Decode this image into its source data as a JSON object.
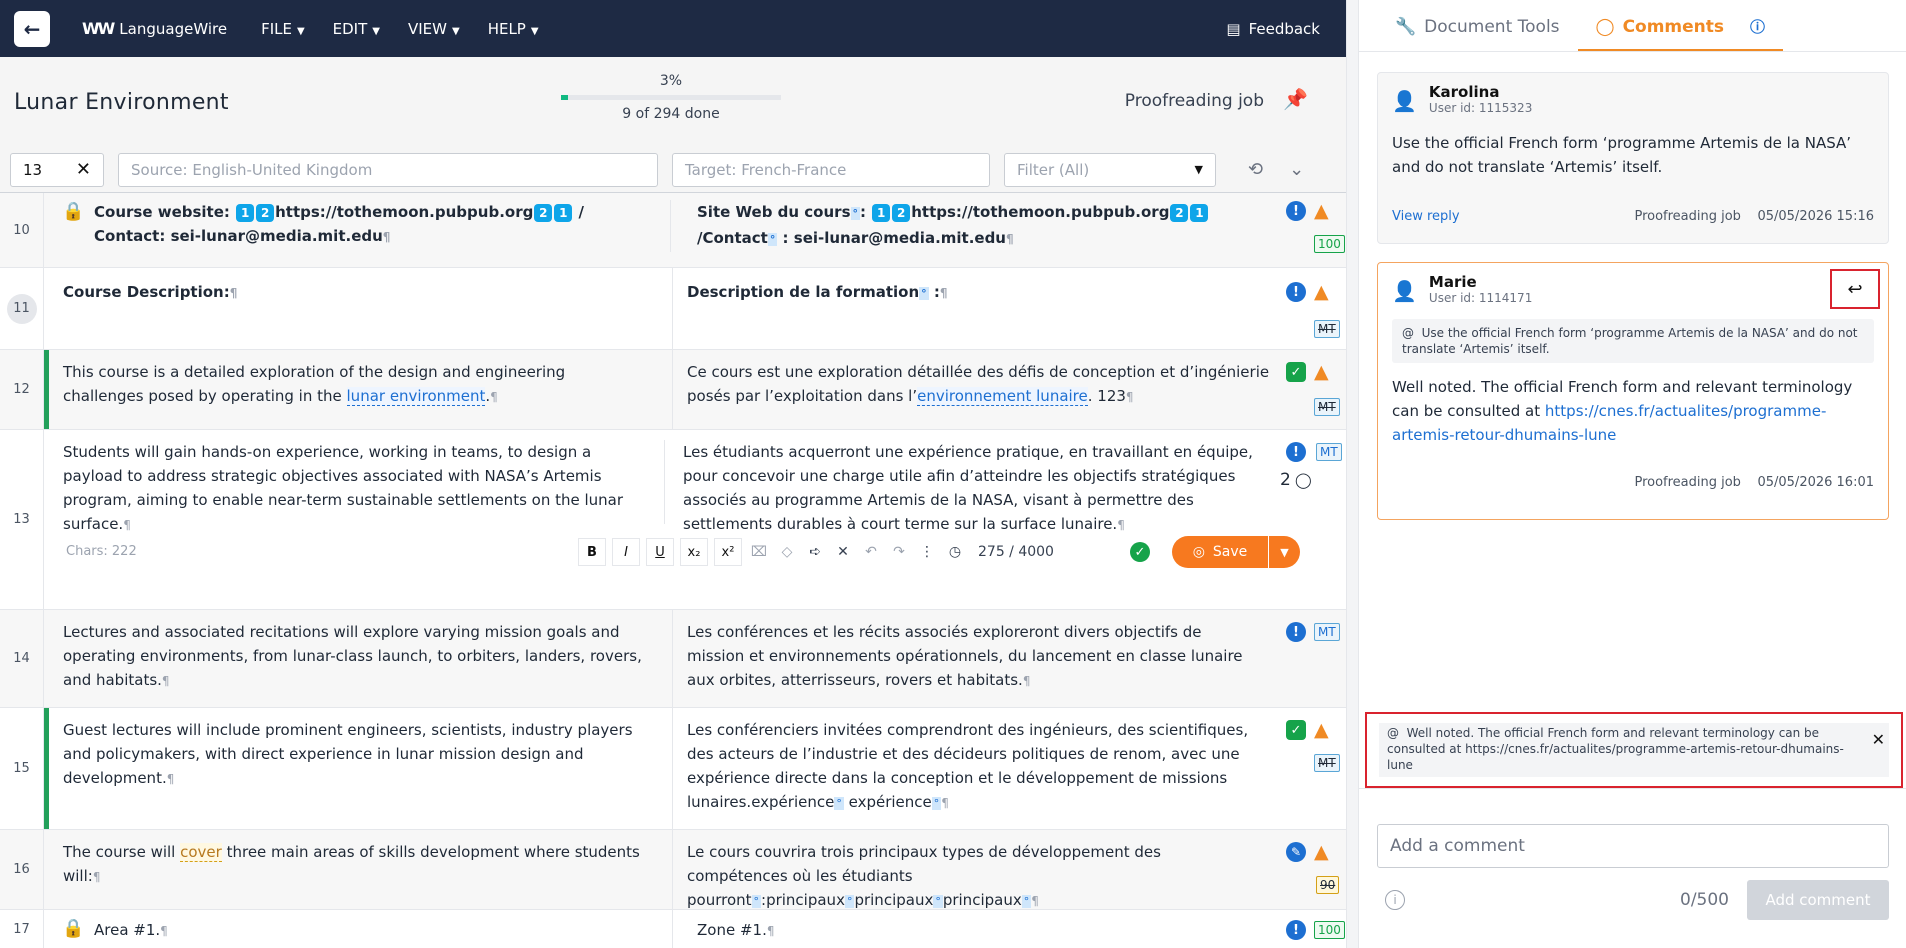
{
  "topbar": {
    "brand": "LanguageWire",
    "menu": [
      "FILE",
      "EDIT",
      "VIEW",
      "HELP"
    ],
    "feedback": "Feedback"
  },
  "doc": {
    "title": "Lunar Environment",
    "progress_percent": "3%",
    "progress_fraction": 0.03,
    "progress_text": "9 of 294 done",
    "job": "Proofreading job"
  },
  "filters": {
    "segment_number": "13",
    "source_placeholder": "Source: English-United Kingdom",
    "target_placeholder": "Target: French-France",
    "filter_value": "Filter (All)"
  },
  "segments": [
    {
      "id": "10",
      "src_a": "Course website: ",
      "src_b": "https://tothemoon.pubpub.org",
      "src_c": " / Contact: sei-lunar@media.mit.edu",
      "tgt_a": "Site Web du cours",
      "tgt_b": "https://tothemoon.pubpub.org",
      "tgt_c": " /Contact",
      "tgt_d": " : sei-lunar@media.mit.edu",
      "badge": "100"
    },
    {
      "id": "11",
      "src": "Course Description:",
      "tgt": "Description de la formation",
      "tgt_after": " :",
      "badge": "MT"
    },
    {
      "id": "12",
      "src_a": "This course is a detailed exploration of the design and engineering challenges posed by operating in the ",
      "src_term": "lunar environment",
      "src_c": ".",
      "tgt_a": "Ce cours est une exploration détaillée des défis de conception et d’ingénierie posés par l’exploitation dans l’",
      "tgt_term": "environnement lunaire",
      "tgt_c": ". 123",
      "badge": "MT"
    },
    {
      "id": "13",
      "src": "Students will gain hands-on experience, working in teams, to design a payload to address strategic objectives associated with NASA’s Artemis program, aiming to enable near-term sustainable settlements on the lunar surface.",
      "tgt": "Les étudiants acquerront une expérience pratique, en travaillant en équipe, pour concevoir une charge utile afin d’atteindre les objectifs stratégiques associés au programme Artemis de la NASA, visant à permettre des settlements durables à court terme sur la surface lunaire.",
      "badge": "MT",
      "comment_count": "2",
      "chars": "Chars: 222",
      "counter": "275 / 4000",
      "save": "Save"
    },
    {
      "id": "14",
      "src": "Lectures and associated recitations will explore varying mission goals and operating environments, from lunar-class launch, to orbiters, landers, rovers, and habitats.",
      "tgt": "Les conférences et les récits associés exploreront divers objectifs de mission et environnements opérationnels, du lancement en classe lunaire aux orbites, atterrisseurs, rovers et habitats.",
      "badge": "MT"
    },
    {
      "id": "15",
      "src": "Guest lectures will include prominent engineers, scientists, industry players and policymakers, with direct experience in lunar mission design and development.",
      "tgt_a": "Les conférenciers invitées comprendront des ingénieurs, des scientifiques, des acteurs de l’industrie et des décideurs politiques de renom, avec une expérience directe dans la conception et le développement de missions lunaires.expérience",
      "tgt_b": "expérience",
      "badge": "MT"
    },
    {
      "id": "16",
      "src_a": "The course will ",
      "src_hl": "cover",
      "src_c": " three main areas of skills development where students will:",
      "tgt_a": "Le cours couvrira trois principaux types de développement des compétences où les étudiants pourront",
      "tgt_b": ":principaux",
      "tgt_c": "principaux",
      "tgt_d": "principaux",
      "badge": "90"
    },
    {
      "id": "17",
      "src": "Area #1.",
      "tgt": "Zone #1.",
      "badge": "100"
    }
  ],
  "panel": {
    "tab_tools": "Document Tools",
    "tab_comments": "Comments",
    "comments": [
      {
        "name": "Karolina",
        "uid": "User id: 1115323",
        "text": "Use the official French form ‘programme Artemis de la NASA’ and do not translate ‘Artemis’ itself.",
        "view_reply": "View reply",
        "job": "Proofreading job",
        "date": "05/05/2026 15:16"
      },
      {
        "name": "Marie",
        "uid": "User id: 1114171",
        "quote": "Use the official French form ‘programme Artemis de la NASA’ and do not translate ‘Artemis’ itself.",
        "text": "Well noted. The official French form and relevant terminology can be consulted at ",
        "link": "https://cnes.fr/actualites/programme-artemis-retour-dhumains-lune",
        "job": "Proofreading job",
        "date": "05/05/2026 16:01"
      }
    ],
    "reply_quote": "Well noted. The official French form and relevant terminology can be consulted at https://cnes.fr/actualites/programme-artemis-retour-dhumains-lune",
    "add_placeholder": "Add a comment",
    "char_count": "0/500",
    "add_button": "Add comment"
  },
  "colors": {
    "topbar": "#1e2a44",
    "accent": "#f08a24",
    "link": "#1d6fd1",
    "confirmed": "#16a34a",
    "highlight_border": "#d9232e"
  }
}
